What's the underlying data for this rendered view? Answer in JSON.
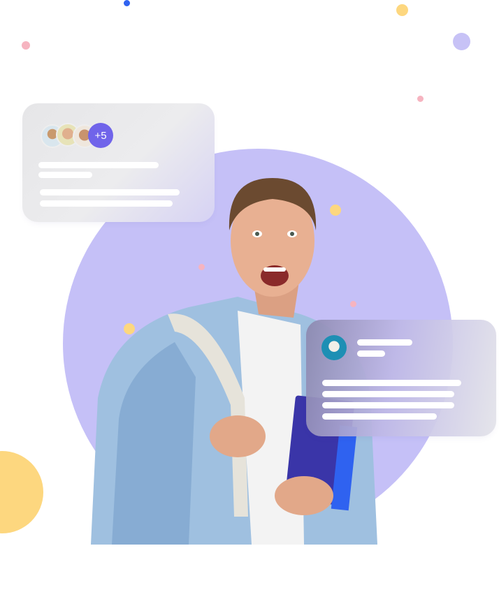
{
  "colors": {
    "circle": "#c5c0f7",
    "accent": "#7064ea",
    "yellow": "#fdd77f",
    "pink": "#f6b4c0",
    "blue": "#2f62f0",
    "lavender": "#c7c2f6"
  },
  "group_card": {
    "avatars": [
      "woman-with-hat-avatar",
      "smiling-man-avatar",
      "man-avatar"
    ],
    "extra_count": "+5"
  },
  "profile_card": {
    "avatar": "man-with-cowboy-hat-avatar"
  },
  "hero_image": "excited-student-with-backpack-and-notebooks"
}
